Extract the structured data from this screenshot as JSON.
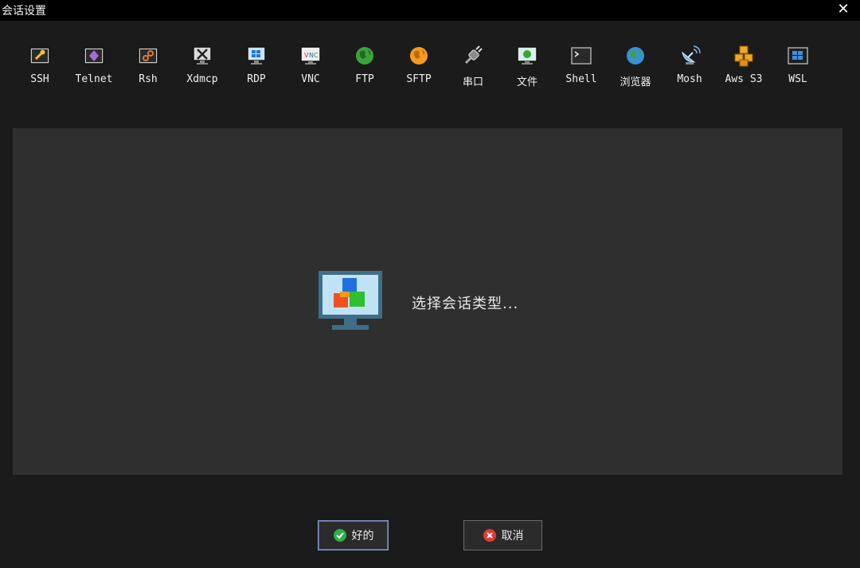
{
  "window": {
    "title": "会话设置",
    "close_label": "✕"
  },
  "toolbar": {
    "items": [
      {
        "label": "SSH",
        "icon": "key-icon"
      },
      {
        "label": "Telnet",
        "icon": "telnet-icon"
      },
      {
        "label": "Rsh",
        "icon": "rsh-icon"
      },
      {
        "label": "Xdmcp",
        "icon": "xdmcp-icon"
      },
      {
        "label": "RDP",
        "icon": "rdp-icon"
      },
      {
        "label": "VNC",
        "icon": "vnc-icon"
      },
      {
        "label": "FTP",
        "icon": "ftp-globe-icon"
      },
      {
        "label": "SFTP",
        "icon": "sftp-globe-icon"
      },
      {
        "label": "串口",
        "icon": "serial-plug-icon"
      },
      {
        "label": "文件",
        "icon": "file-icon"
      },
      {
        "label": "Shell",
        "icon": "shell-terminal-icon"
      },
      {
        "label": "浏览器",
        "icon": "browser-globe-icon"
      },
      {
        "label": "Mosh",
        "icon": "mosh-satellite-icon"
      },
      {
        "label": "Aws S3",
        "icon": "aws-s3-cubes-icon"
      },
      {
        "label": "WSL",
        "icon": "wsl-windows-icon"
      }
    ]
  },
  "panel": {
    "hint": "选择会话类型...",
    "hint_icon": "monitor-cubes-icon"
  },
  "buttons": {
    "ok_label": "好的",
    "cancel_label": "取消"
  }
}
